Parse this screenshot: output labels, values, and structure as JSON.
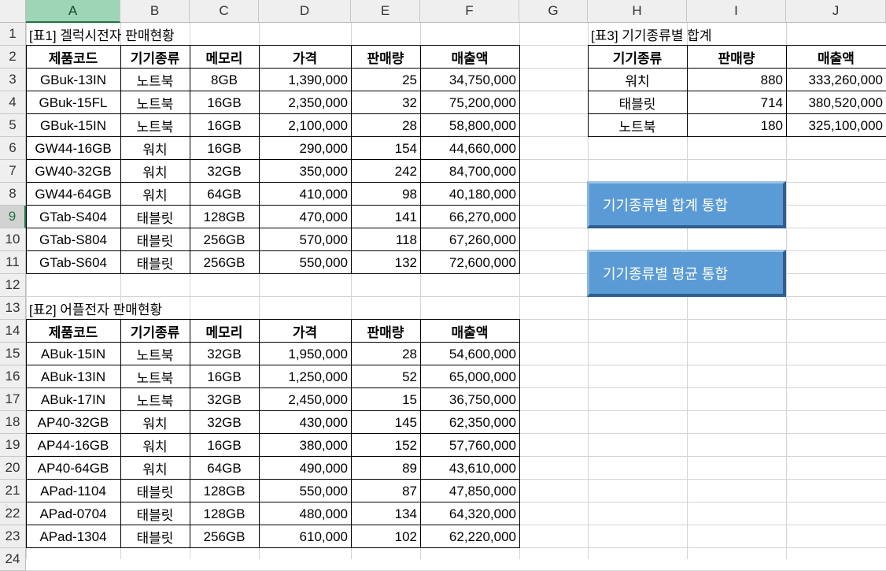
{
  "columns": [
    "A",
    "B",
    "C",
    "D",
    "E",
    "F",
    "G",
    "H",
    "I",
    "J"
  ],
  "rows": [
    "1",
    "2",
    "3",
    "4",
    "5",
    "6",
    "7",
    "8",
    "9",
    "10",
    "11",
    "12",
    "13",
    "14",
    "15",
    "16",
    "17",
    "18",
    "19",
    "20",
    "21",
    "22",
    "23",
    "24"
  ],
  "selected_column": "A",
  "selected_row": "9",
  "table1": {
    "title": "[표1] 겔럭시전자 판매현황",
    "headers": [
      "제품코드",
      "기기종류",
      "메모리",
      "가격",
      "판매량",
      "매출액"
    ],
    "rows": [
      [
        "GBuk-13IN",
        "노트북",
        "8GB",
        "1,390,000",
        "25",
        "34,750,000"
      ],
      [
        "GBuk-15FL",
        "노트북",
        "16GB",
        "2,350,000",
        "32",
        "75,200,000"
      ],
      [
        "GBuk-15IN",
        "노트북",
        "16GB",
        "2,100,000",
        "28",
        "58,800,000"
      ],
      [
        "GW44-16GB",
        "워치",
        "16GB",
        "290,000",
        "154",
        "44,660,000"
      ],
      [
        "GW40-32GB",
        "워치",
        "32GB",
        "350,000",
        "242",
        "84,700,000"
      ],
      [
        "GW44-64GB",
        "워치",
        "64GB",
        "410,000",
        "98",
        "40,180,000"
      ],
      [
        "GTab-S404",
        "태블릿",
        "128GB",
        "470,000",
        "141",
        "66,270,000"
      ],
      [
        "GTab-S804",
        "태블릿",
        "256GB",
        "570,000",
        "118",
        "67,260,000"
      ],
      [
        "GTab-S604",
        "태블릿",
        "256GB",
        "550,000",
        "132",
        "72,600,000"
      ]
    ]
  },
  "table2": {
    "title": "[표2] 어플전자 판매현황",
    "headers": [
      "제품코드",
      "기기종류",
      "메모리",
      "가격",
      "판매량",
      "매출액"
    ],
    "rows": [
      [
        "ABuk-15IN",
        "노트북",
        "32GB",
        "1,950,000",
        "28",
        "54,600,000"
      ],
      [
        "ABuk-13IN",
        "노트북",
        "16GB",
        "1,250,000",
        "52",
        "65,000,000"
      ],
      [
        "ABuk-17IN",
        "노트북",
        "32GB",
        "2,450,000",
        "15",
        "36,750,000"
      ],
      [
        "AP40-32GB",
        "워치",
        "32GB",
        "430,000",
        "145",
        "62,350,000"
      ],
      [
        "AP44-16GB",
        "워치",
        "16GB",
        "380,000",
        "152",
        "57,760,000"
      ],
      [
        "AP40-64GB",
        "워치",
        "64GB",
        "490,000",
        "89",
        "43,610,000"
      ],
      [
        "APad-1104",
        "태블릿",
        "128GB",
        "550,000",
        "87",
        "47,850,000"
      ],
      [
        "APad-0704",
        "태블릿",
        "128GB",
        "480,000",
        "134",
        "64,320,000"
      ],
      [
        "APad-1304",
        "태블릿",
        "256GB",
        "610,000",
        "102",
        "62,220,000"
      ]
    ]
  },
  "table3": {
    "title": "[표3] 기기종류별 합계",
    "headers": [
      "기기종류",
      "판매량",
      "매출액"
    ],
    "rows": [
      [
        "워치",
        "880",
        "333,260,000"
      ],
      [
        "태블릿",
        "714",
        "380,520,000"
      ],
      [
        "노트북",
        "180",
        "325,100,000"
      ]
    ]
  },
  "buttons": {
    "sum_label": "기기종류별 합계 통합",
    "avg_label": "기기종류별 평균 통합"
  }
}
